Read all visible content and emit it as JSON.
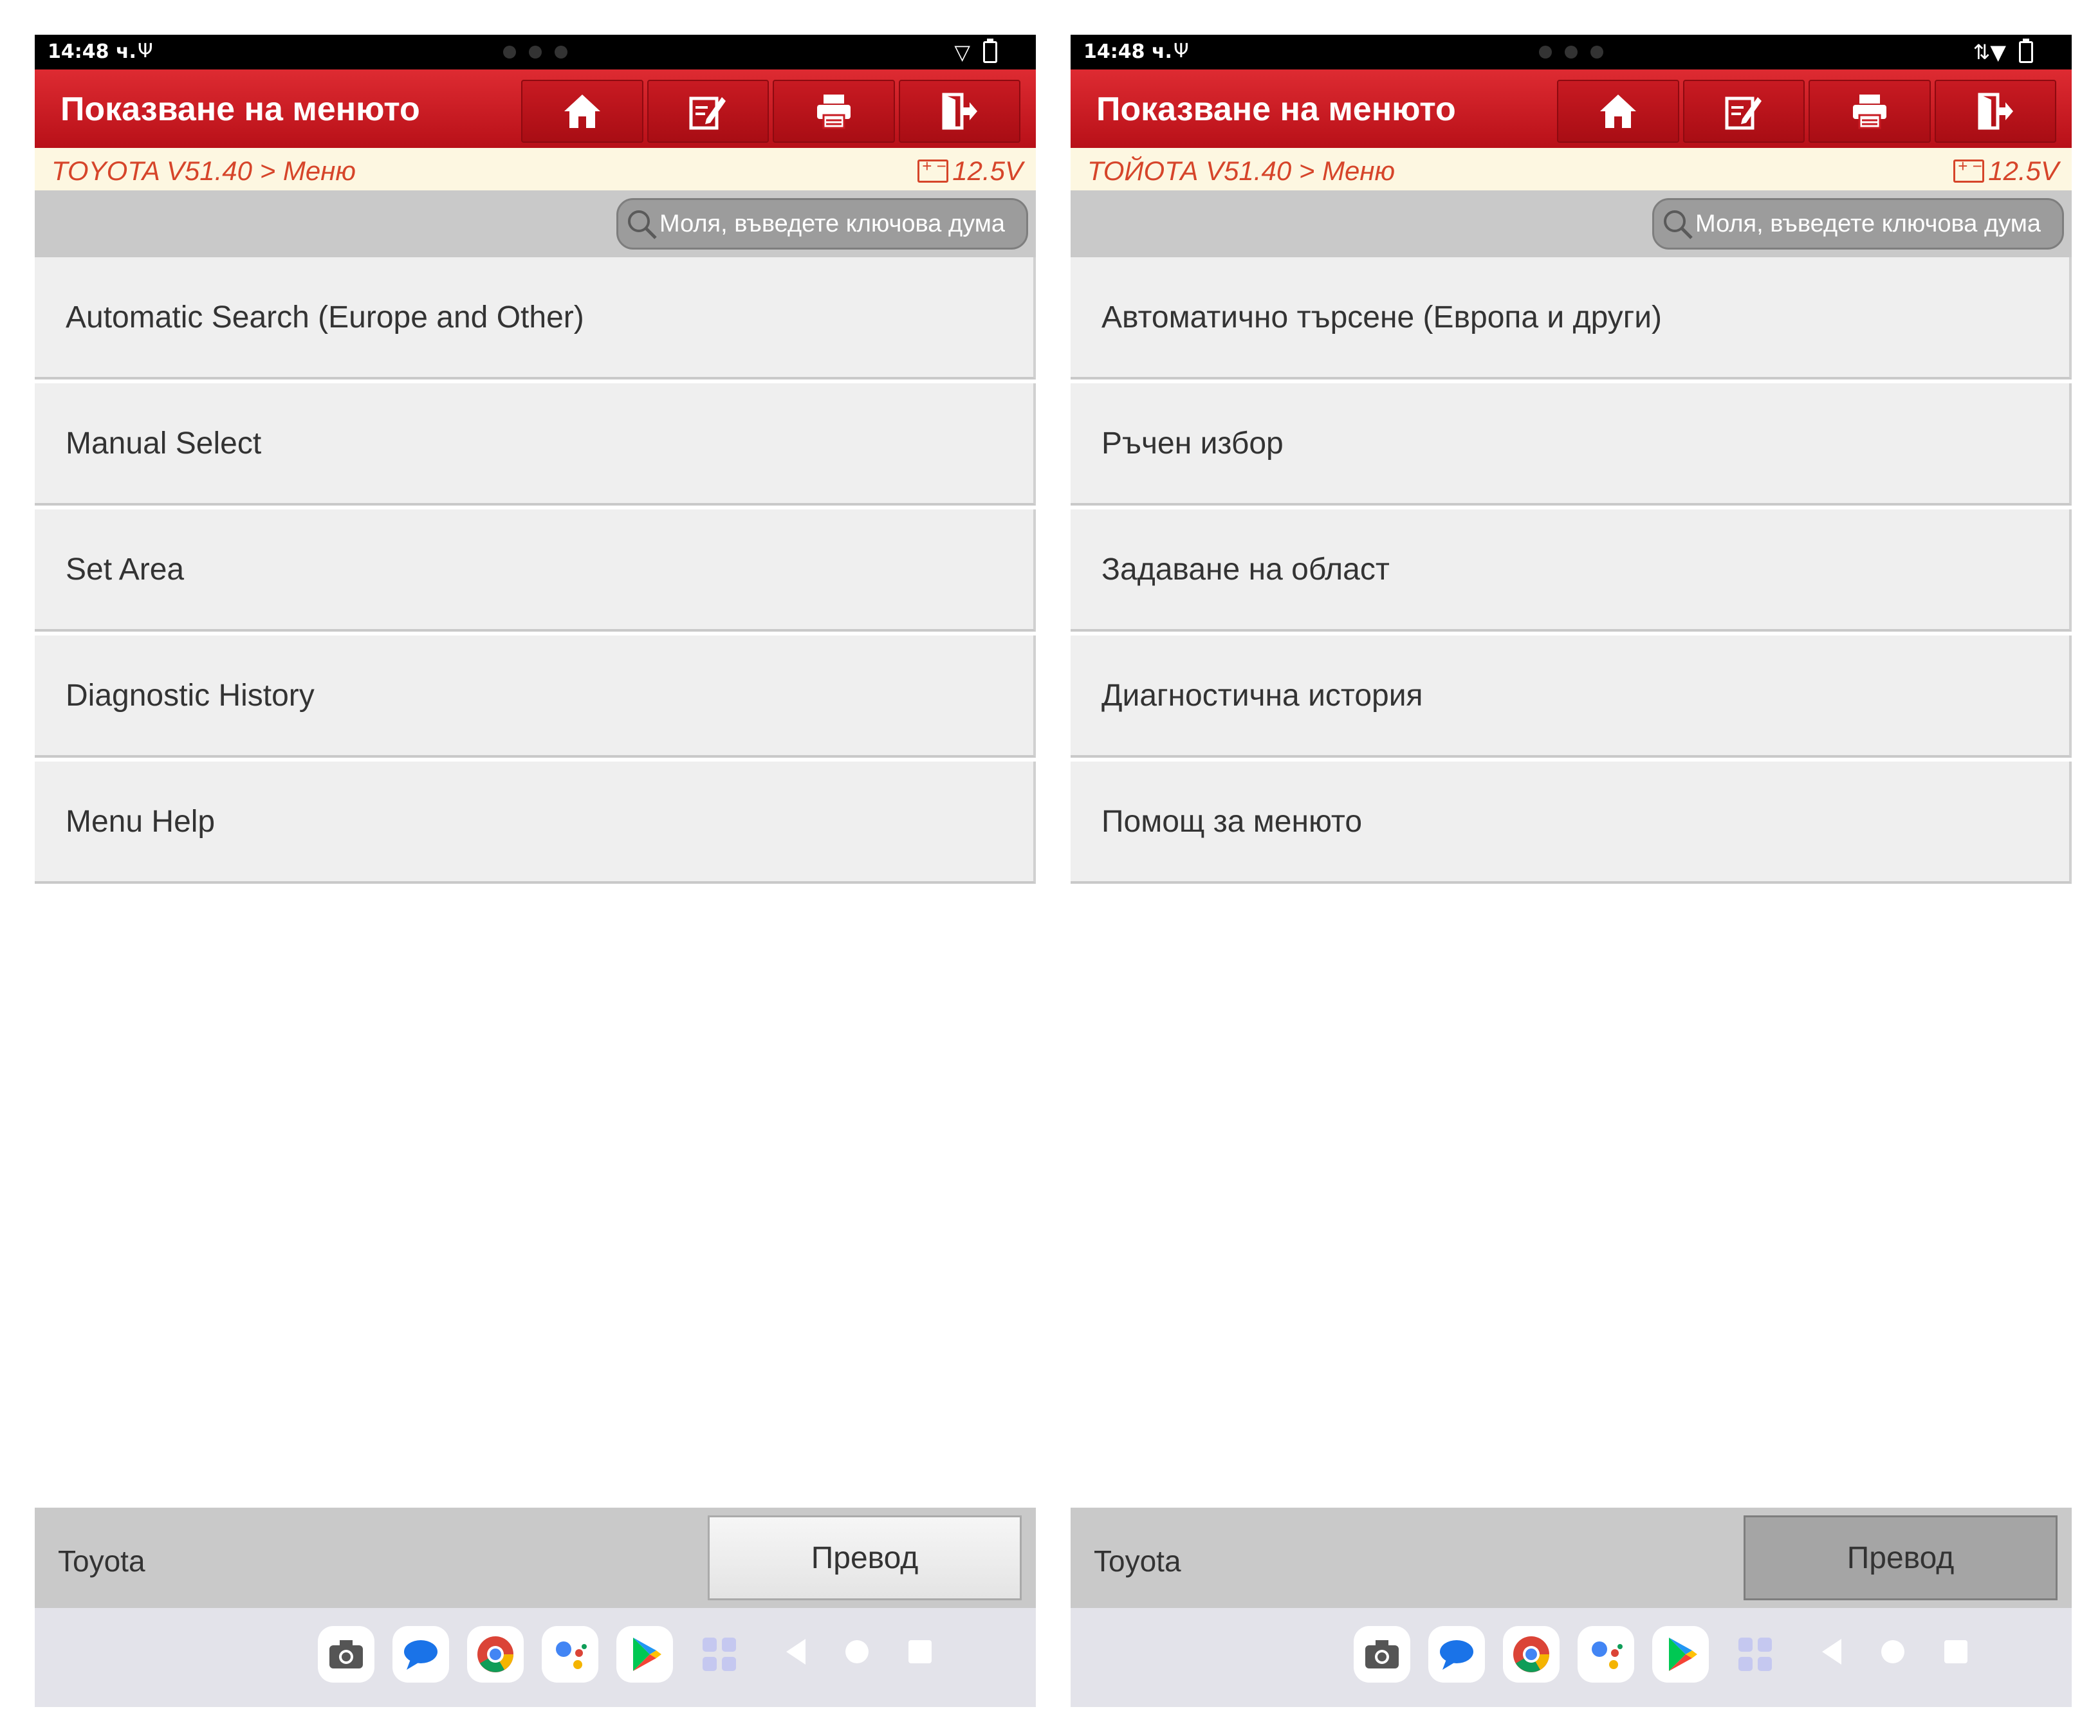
{
  "status_bar": {
    "time": "14:48 ч.",
    "usb_glyph": "Ψ"
  },
  "header": {
    "title": "Показване на менюто",
    "toolbar": [
      "home-icon",
      "edit-icon",
      "print-icon",
      "exit-icon"
    ]
  },
  "search": {
    "placeholder": "Моля, въведете ключова дума"
  },
  "voltage": "12.5V",
  "footer": {
    "label": "Toyota",
    "translate_label": "Превод"
  },
  "colors": {
    "header_red": "#d2232a",
    "breadcrumb_orange": "#d6452a",
    "panel_gray": "#c9c9c9",
    "item_bg": "#efefef"
  },
  "panes": {
    "left": {
      "breadcrumb": "TOYOTA V51.40 > Меню",
      "menu_items": [
        "Automatic Search (Europe and Other)",
        "Manual Select",
        "Set Area",
        "Diagnostic History",
        "Menu Help"
      ],
      "translate_pressed": false
    },
    "right": {
      "breadcrumb": "ТОЙОТА V51.40 > Меню",
      "menu_items": [
        "Автоматично търсене (Европа и други)",
        "Ръчен избор",
        "Задаване на област",
        "Диагностична история",
        "Помощ за менюто"
      ],
      "translate_pressed": true
    }
  },
  "dock_apps": [
    "camera-icon",
    "messages-icon",
    "chrome-icon",
    "assistant-icon",
    "play-store-icon",
    "app-drawer-icon"
  ]
}
